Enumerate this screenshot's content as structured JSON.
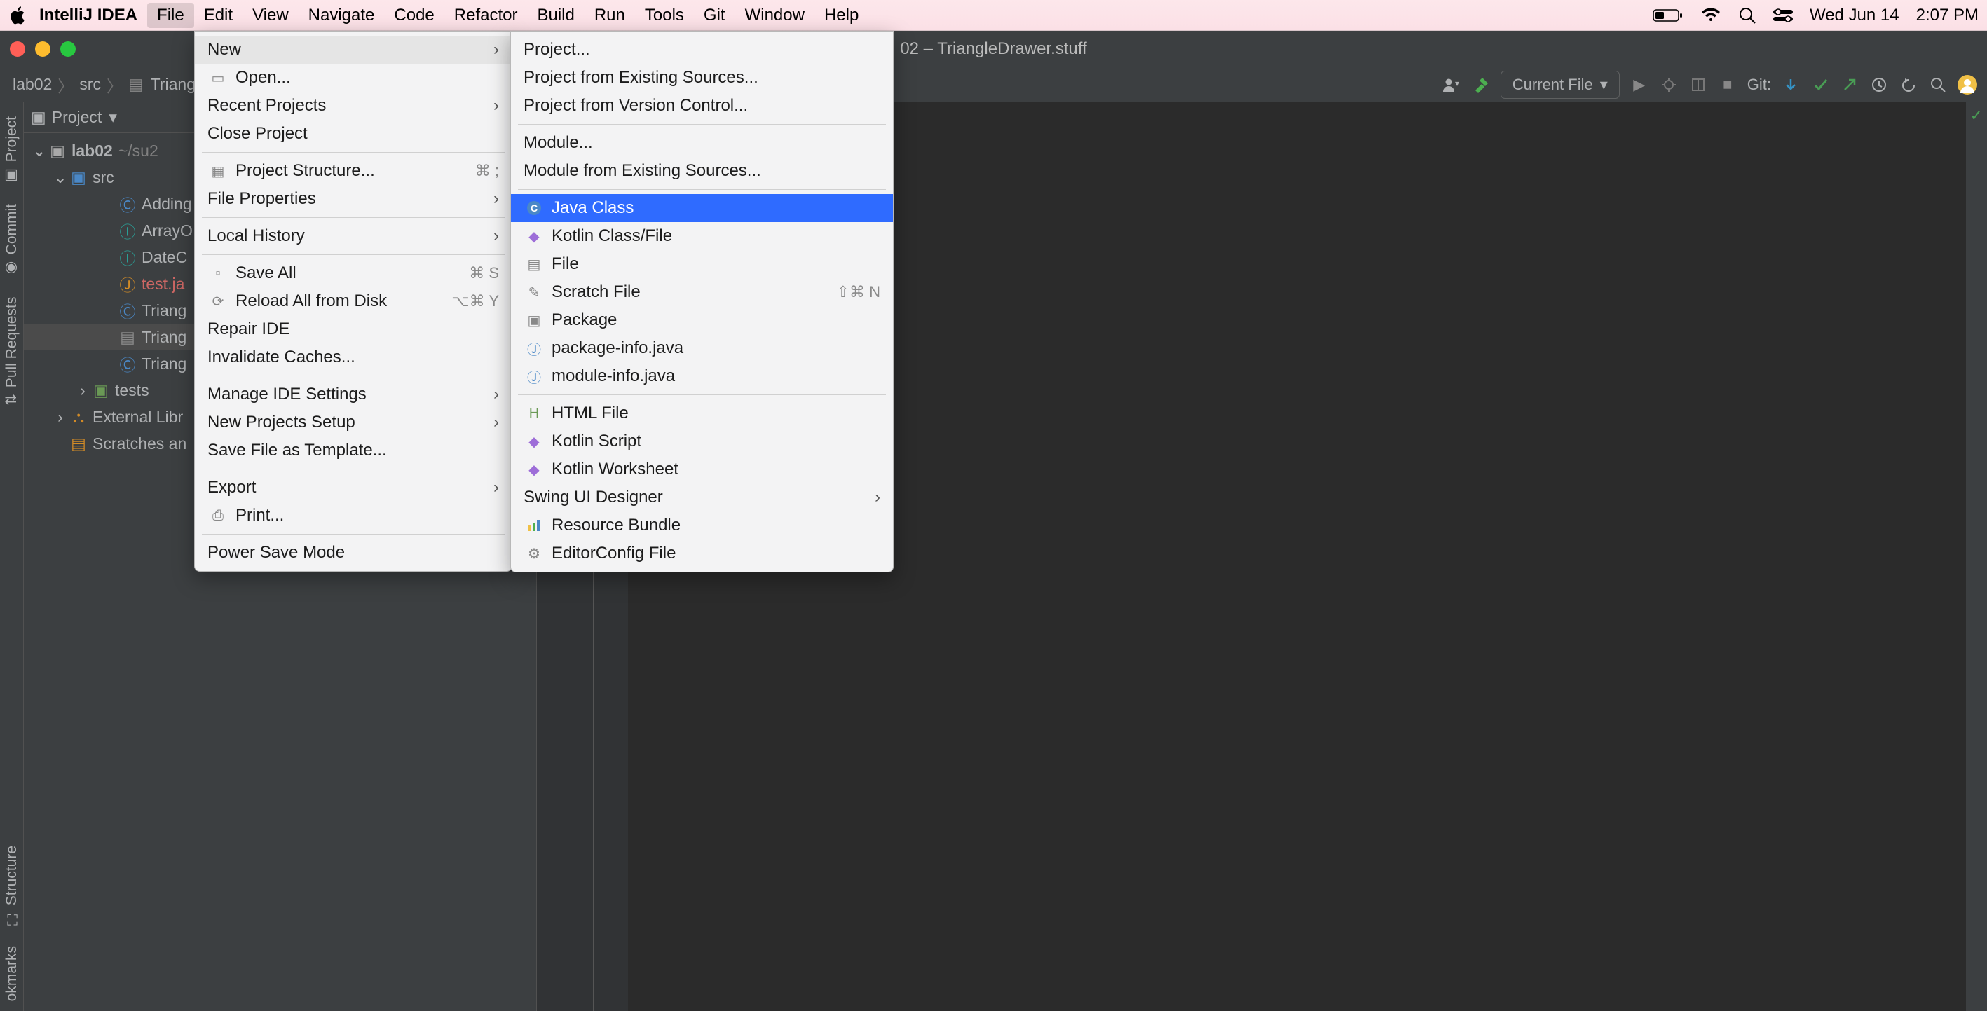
{
  "macos": {
    "app_name": "IntelliJ IDEA",
    "menus": [
      "File",
      "Edit",
      "View",
      "Navigate",
      "Code",
      "Refactor",
      "Build",
      "Run",
      "Tools",
      "Git",
      "Window",
      "Help"
    ],
    "active_menu_index": 0,
    "date": "Wed Jun 14",
    "time": "2:07 PM"
  },
  "window": {
    "title": "02 – TriangleDrawer.stuff"
  },
  "breadcrumb": [
    "lab02",
    "src",
    "Triang"
  ],
  "toolbar": {
    "current_file": "Current File",
    "git_label": "Git:"
  },
  "project_panel": {
    "header": "Project",
    "root": {
      "name": "lab02",
      "path": "~/su2"
    },
    "src": "src",
    "files": [
      {
        "name": "Adding",
        "type": "class"
      },
      {
        "name": "ArrayO",
        "type": "interface"
      },
      {
        "name": "DateC",
        "type": "interface"
      },
      {
        "name": "test.ja",
        "type": "java-red"
      },
      {
        "name": "Triang",
        "type": "class"
      },
      {
        "name": "Triang",
        "type": "file-selected"
      },
      {
        "name": "Triang",
        "type": "class"
      }
    ],
    "tests": "tests",
    "ext_lib": "External Libr",
    "scratches": "Scratches an"
  },
  "left_gutter": {
    "project": "Project",
    "commit": "Commit",
    "pull_requests": "Pull Requests",
    "structure": "Structure",
    "bookmarks": "okmarks"
  },
  "file_menu": {
    "new": "New",
    "open": "Open...",
    "recent": "Recent Projects",
    "close": "Close Project",
    "structure": "Project Structure...",
    "structure_sc": "⌘ ;",
    "properties": "File Properties",
    "history": "Local History",
    "save_all": "Save All",
    "save_all_sc": "⌘ S",
    "reload": "Reload All from Disk",
    "reload_sc": "⌥⌘ Y",
    "repair": "Repair IDE",
    "invalidate": "Invalidate Caches...",
    "manage": "Manage IDE Settings",
    "new_proj_setup": "New Projects Setup",
    "save_template": "Save File as Template...",
    "export": "Export",
    "print": "Print...",
    "power_save": "Power Save Mode"
  },
  "new_submenu": {
    "project": "Project...",
    "proj_existing": "Project from Existing Sources...",
    "proj_vc": "Project from Version Control...",
    "module": "Module...",
    "module_existing": "Module from Existing Sources...",
    "java_class": "Java Class",
    "kotlin_class": "Kotlin Class/File",
    "file": "File",
    "scratch": "Scratch File",
    "scratch_sc": "⇧⌘ N",
    "package": "Package",
    "pkg_info": "package-info.java",
    "mod_info": "module-info.java",
    "html": "HTML File",
    "kotlin_script": "Kotlin Script",
    "kotlin_ws": "Kotlin Worksheet",
    "swing": "Swing UI Designer",
    "resource": "Resource Bundle",
    "editorconfig": "EditorConfig File"
  }
}
